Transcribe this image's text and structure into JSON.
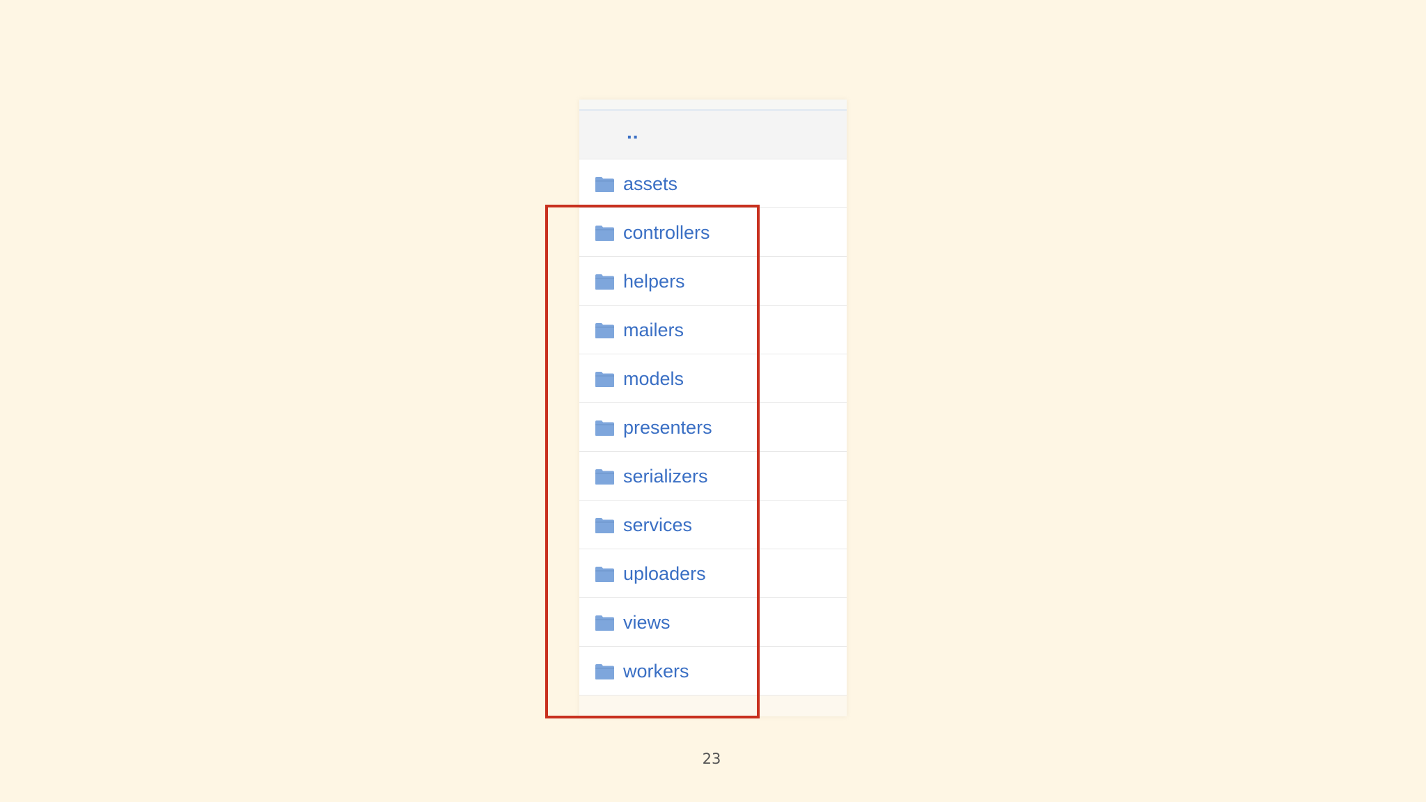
{
  "listing": {
    "parent_link": "..",
    "folders": [
      {
        "name": "assets",
        "icon": "folder-icon"
      },
      {
        "name": "controllers",
        "icon": "folder-icon"
      },
      {
        "name": "helpers",
        "icon": "folder-icon"
      },
      {
        "name": "mailers",
        "icon": "folder-icon"
      },
      {
        "name": "models",
        "icon": "folder-icon"
      },
      {
        "name": "presenters",
        "icon": "folder-icon"
      },
      {
        "name": "serializers",
        "icon": "folder-icon"
      },
      {
        "name": "services",
        "icon": "folder-icon"
      },
      {
        "name": "uploaders",
        "icon": "folder-icon"
      },
      {
        "name": "views",
        "icon": "folder-icon"
      },
      {
        "name": "workers",
        "icon": "folder-icon"
      }
    ]
  },
  "slide": {
    "page_number": "23"
  },
  "colors": {
    "background": "#fef6e4",
    "link": "#3a6fc4",
    "folder": "#7ea6dc",
    "highlight": "#c8301e"
  }
}
